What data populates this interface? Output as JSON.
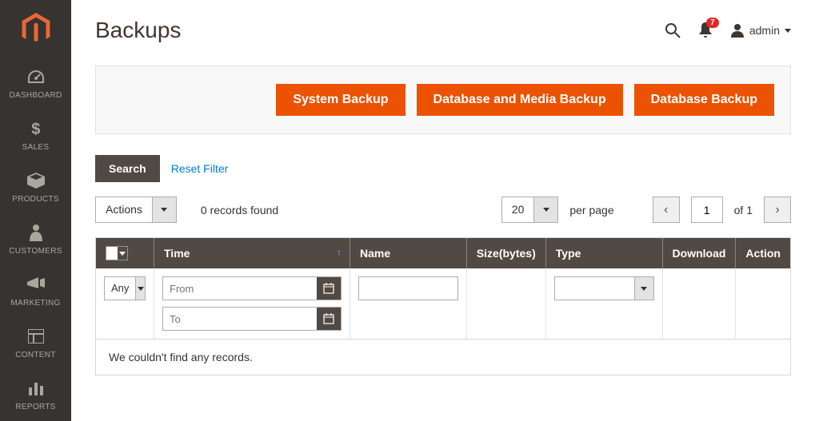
{
  "header": {
    "title": "Backups",
    "notification_count": "7",
    "admin_label": "admin"
  },
  "actions": {
    "system_backup": "System Backup",
    "db_media_backup": "Database and Media Backup",
    "db_backup": "Database Backup"
  },
  "toolbar": {
    "search_label": "Search",
    "reset_filter_label": "Reset Filter",
    "actions_label": "Actions",
    "records_found": "0 records found",
    "page_size": "20",
    "per_page_label": "per page",
    "current_page": "1",
    "total_pages_text": "of 1"
  },
  "grid": {
    "columns": {
      "time": "Time",
      "name": "Name",
      "size": "Size(bytes)",
      "type": "Type",
      "download": "Download",
      "action": "Action"
    },
    "filters": {
      "any": "Any",
      "from_placeholder": "From",
      "to_placeholder": "To"
    },
    "empty_message": "We couldn't find any records."
  },
  "sidebar": {
    "items": [
      {
        "label": "DASHBOARD"
      },
      {
        "label": "SALES"
      },
      {
        "label": "PRODUCTS"
      },
      {
        "label": "CUSTOMERS"
      },
      {
        "label": "MARKETING"
      },
      {
        "label": "CONTENT"
      },
      {
        "label": "REPORTS"
      }
    ]
  }
}
